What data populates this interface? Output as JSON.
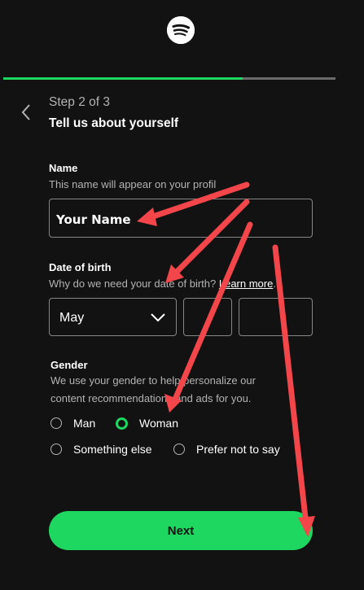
{
  "header": {
    "logo_icon": "spotify-logo-icon",
    "progress": 0.72
  },
  "step": {
    "back_icon": "chevron-left-icon",
    "label": "Step 2 of 3",
    "title": "Tell us about yourself"
  },
  "name_field": {
    "label": "Name",
    "help": "This name will appear on your profil",
    "value": "Your Name"
  },
  "dob_field": {
    "label": "Date of birth",
    "help_prefix": "Why do we need your date of birth? ",
    "help_link": "Learn more",
    "help_suffix": ".",
    "month_value": "May",
    "month_icon": "chevron-down-icon",
    "day_value": "",
    "year_value": ""
  },
  "gender_field": {
    "label": "Gender",
    "help_line1": "We use your gender to help personalize our",
    "help_line2": "content recommendations and ads for you.",
    "options": [
      {
        "label": "Man",
        "checked": false
      },
      {
        "label": "Woman",
        "checked": true
      },
      {
        "label": "Something else",
        "checked": false
      },
      {
        "label": "Prefer not to say",
        "checked": false
      }
    ]
  },
  "actions": {
    "next_label": "Next"
  },
  "colors": {
    "background": "#121212",
    "accent": "#1ed760",
    "annotation_arrow": "#f2464b",
    "muted_text": "#b3b3b3",
    "border": "#878787"
  }
}
